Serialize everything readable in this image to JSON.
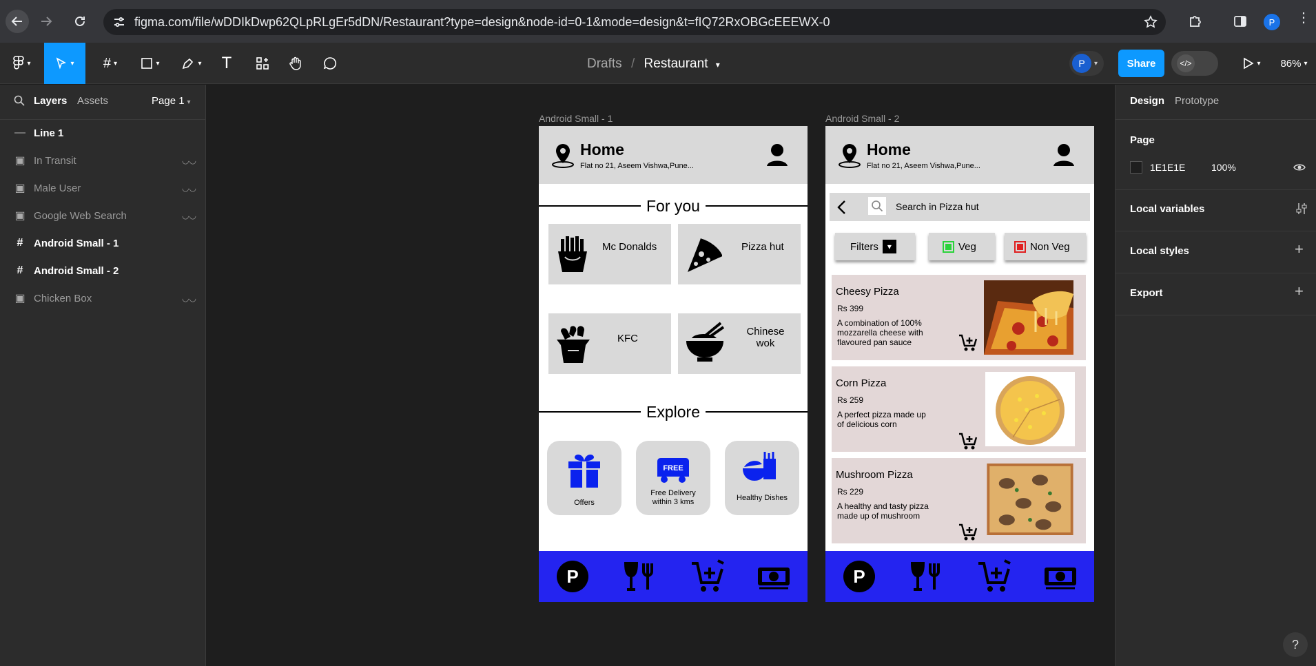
{
  "browser": {
    "url": "figma.com/file/wDDIkDwp62QLpRLgEr5dDN/Restaurant?type=design&node-id=0-1&mode=design&t=fIQ72RxOBGcEEEWX-0",
    "profile_initial": "P"
  },
  "toolbar": {
    "breadcrumb_parent": "Drafts",
    "breadcrumb_separator": "/",
    "file_name": "Restaurant",
    "avatar_initial": "P",
    "share_label": "Share",
    "zoom": "86%"
  },
  "left_panel": {
    "tabs": [
      "Layers",
      "Assets"
    ],
    "page_selector": "Page 1",
    "layers": [
      {
        "name": "Line 1",
        "type": "line",
        "bold": true,
        "hidden": false
      },
      {
        "name": "In Transit",
        "type": "image",
        "bold": false,
        "hidden": true
      },
      {
        "name": "Male User",
        "type": "image",
        "bold": false,
        "hidden": true
      },
      {
        "name": "Google Web Search",
        "type": "image",
        "bold": false,
        "hidden": true
      },
      {
        "name": "Android Small - 1",
        "type": "frame",
        "bold": true,
        "hidden": false
      },
      {
        "name": "Android Small - 2",
        "type": "frame",
        "bold": true,
        "hidden": false
      },
      {
        "name": "Chicken Box",
        "type": "image",
        "bold": false,
        "hidden": true
      }
    ]
  },
  "right_panel": {
    "tabs": [
      "Design",
      "Prototype"
    ],
    "page_heading": "Page",
    "page_color": "1E1E1E",
    "page_opacity": "100%",
    "sections": [
      "Local variables",
      "Local styles",
      "Export"
    ]
  },
  "canvas": {
    "frame1": {
      "label": "Android Small - 1",
      "header_title": "Home",
      "header_address": "Flat no 21, Aseem Vishwa,Pune...",
      "section1": "For you",
      "restaurants": [
        {
          "name": "Mc Donalds",
          "icon": "fries-icon"
        },
        {
          "name": "Pizza hut",
          "icon": "pizza-slice-icon"
        },
        {
          "name": "KFC",
          "icon": "chicken-box-icon"
        },
        {
          "name": "Chinese wok",
          "icon": "noodle-bowl-icon"
        }
      ],
      "section2": "Explore",
      "explore": [
        {
          "label": "Offers",
          "icon": "gift-icon"
        },
        {
          "label": "Free Delivery within 3 kms",
          "icon": "free-delivery-icon"
        },
        {
          "label": "Healthy Dishes",
          "icon": "healthy-dish-icon"
        }
      ]
    },
    "frame2": {
      "label": "Android Small - 2",
      "header_title": "Home",
      "header_address": "Flat no 21, Aseem Vishwa,Pune...",
      "search_placeholder": "Search in Pizza hut",
      "filters": [
        "Filters",
        "Veg",
        "Non Veg"
      ],
      "items": [
        {
          "name": "Cheesy Pizza",
          "price": "Rs 399",
          "desc": "A combination of 100% mozzarella cheese with flavoured pan sauce"
        },
        {
          "name": "Corn Pizza",
          "price": "Rs 259",
          "desc": "A perfect pizza made up of delicious corn"
        },
        {
          "name": "Mushroom Pizza",
          "price": "Rs 229",
          "desc": "A healthy and tasty pizza made up of mushroom"
        }
      ]
    },
    "bottom_nav_icons": [
      "parking-icon",
      "dining-icon",
      "cart-add-icon",
      "money-icon"
    ],
    "bottom_bar_color": "#2424f0"
  },
  "help_label": "?"
}
